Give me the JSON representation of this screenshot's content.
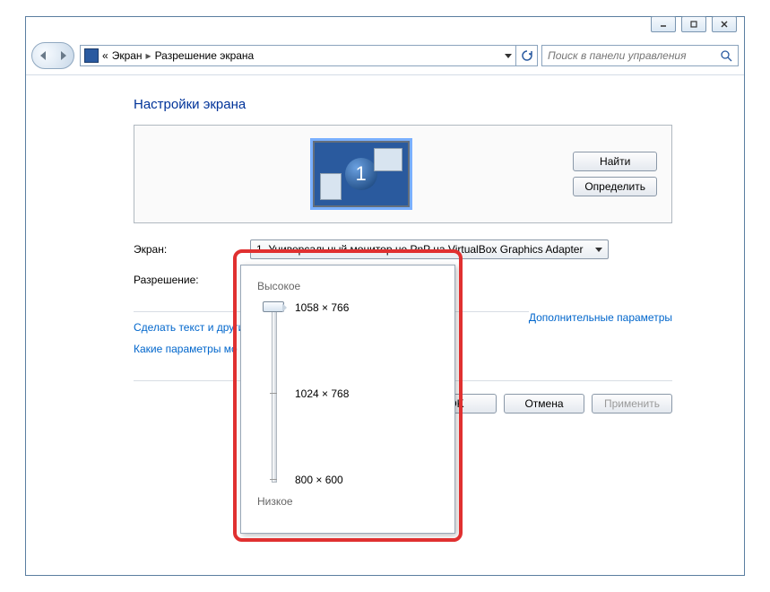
{
  "breadcrumb": {
    "prefix": "«",
    "item1": "Экран",
    "item2": "Разрешение экрана"
  },
  "search": {
    "placeholder": "Поиск в панели управления"
  },
  "page_title": "Настройки экрана",
  "monitor": {
    "number": "1"
  },
  "buttons": {
    "find": "Найти",
    "identify": "Определить",
    "ok": "OK",
    "cancel": "Отмена",
    "apply": "Применить"
  },
  "labels": {
    "display": "Экран:",
    "resolution": "Разрешение:"
  },
  "display_combo": "1. Универсальный монитор не PnP на VirtualBox Graphics Adapter",
  "resolution_combo": "1058 × 766",
  "links": {
    "advanced": "Дополнительные параметры",
    "text_size": "Сделать текст и другие",
    "which": "Какие параметры мо"
  },
  "slider": {
    "high": "Высокое",
    "low": "Низкое",
    "opt1": "1058 × 766",
    "opt2": "1024 × 768",
    "opt3": "800 × 600"
  }
}
